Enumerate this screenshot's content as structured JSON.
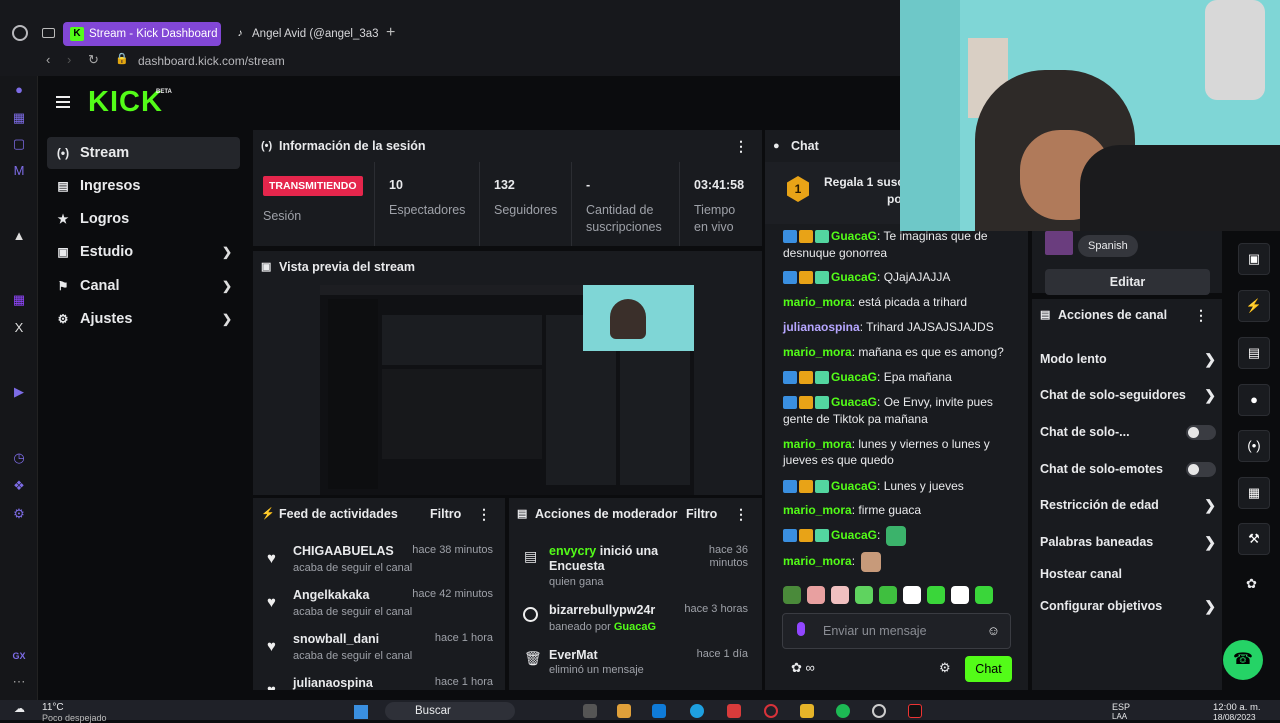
{
  "browser": {
    "tabs": [
      {
        "label": "Stream - Kick Dashboard",
        "active": true
      },
      {
        "label": "Angel Avid (@angel_3a3)",
        "active": false
      }
    ],
    "url": "dashboard.kick.com/stream"
  },
  "brand": {
    "logo_text": "KICK",
    "beta": "BETA",
    "accent": "#53fc18"
  },
  "sidebar": {
    "items": [
      {
        "label": "Stream",
        "icon": "broadcast-icon",
        "active": true
      },
      {
        "label": "Ingresos",
        "icon": "chart-icon"
      },
      {
        "label": "Logros",
        "icon": "trophy-icon"
      },
      {
        "label": "Estudio",
        "icon": "studio-icon",
        "expandable": true
      },
      {
        "label": "Canal",
        "icon": "flag-icon",
        "expandable": true
      },
      {
        "label": "Ajustes",
        "icon": "gear-icon",
        "expandable": true
      }
    ]
  },
  "session": {
    "title": "Información de la sesión",
    "live_badge": "TRANSMITIENDO",
    "session_label": "Sesión",
    "stats": [
      {
        "value": "10",
        "label": "Espectadores"
      },
      {
        "value": "132",
        "label": "Seguidores"
      },
      {
        "value": "-",
        "label": "Cantidad de suscripciones"
      },
      {
        "value": "03:41:58",
        "label": "Tiempo en vivo"
      }
    ]
  },
  "preview": {
    "title": "Vista previa del stream"
  },
  "feed": {
    "title": "Feed de actividades",
    "filter": "Filtro",
    "items": [
      {
        "name": "CHIGAABUELAS",
        "sub": "acaba de seguir el canal",
        "time": "hace 38 minutos"
      },
      {
        "name": "Angelkakaka",
        "sub": "acaba de seguir el canal",
        "time": "hace 42 minutos"
      },
      {
        "name": "snowball_dani",
        "sub": "acaba de seguir el canal",
        "time": "hace 1 hora"
      },
      {
        "name": "julianaospina",
        "sub": "",
        "time": "hace 1 hora"
      }
    ]
  },
  "modactions": {
    "title": "Acciones de moderador",
    "filter": "Filtro",
    "items": [
      {
        "name": "envycry",
        "action": " inició una Encuesta",
        "sub": "quien gana",
        "time": "hace 36 minutos"
      },
      {
        "name": "bizarrebullypw24r",
        "action": "",
        "sub_prefix": "baneado por ",
        "sub_user": "GuacaG",
        "time": "hace 3 horas"
      },
      {
        "name": "EverMat",
        "action": "",
        "sub": "eliminó un mensaje",
        "time": "hace 1 día"
      }
    ]
  },
  "chat": {
    "title": "Chat",
    "pinned": "Regala 1 suscr",
    "pinned2": "po",
    "pinned_rank": "1",
    "messages": [
      {
        "user": "GuacaG",
        "badges": true,
        "color": "green",
        "text": ": Te imaginas que de desnuque gonorrea"
      },
      {
        "user": "GuacaG",
        "badges": true,
        "color": "green",
        "text": ": QJajAJAJJA"
      },
      {
        "user": "mario_mora",
        "badges": false,
        "color": "green",
        "text": ": está picada a trihard"
      },
      {
        "user": "julianaospina",
        "badges": false,
        "color": "purple",
        "text": ": Trihard JAJSAJSJAJDS"
      },
      {
        "user": "mario_mora",
        "badges": false,
        "color": "green",
        "text": ": mañana es que es among?"
      },
      {
        "user": "GuacaG",
        "badges": true,
        "color": "green",
        "text": ": Epa mañana"
      },
      {
        "user": "GuacaG",
        "badges": true,
        "color": "green",
        "text": ": Oe Envy, invite pues gente de Tiktok pa mañana"
      },
      {
        "user": "mario_mora",
        "badges": false,
        "color": "green",
        "text": ": lunes y viernes o lunes y jueves es que quedo"
      },
      {
        "user": "GuacaG",
        "badges": true,
        "color": "green",
        "text": ": Lunes y jueves"
      },
      {
        "user": "mario_mora",
        "badges": false,
        "color": "green",
        "text": ": firme guaca"
      },
      {
        "user": "GuacaG",
        "badges": true,
        "color": "green",
        "text": ":"
      },
      {
        "user": "mario_mora",
        "badges": false,
        "color": "green",
        "text": ":"
      }
    ],
    "input_placeholder": "Enviar un mensaje",
    "send": "Chat",
    "emote_colors": [
      "#4a8a3a",
      "#e8a0a0",
      "#f0c0c0",
      "#5fd35f",
      "#3fbf3f",
      "#ffffff",
      "#3ad63a",
      "#ffffff",
      "#3ad63a"
    ]
  },
  "channel_info": {
    "language": "Spanish",
    "edit": "Editar"
  },
  "channel_actions": {
    "title": "Acciones de canal",
    "items": [
      {
        "label": "Modo lento",
        "kind": "arrow"
      },
      {
        "label": "Chat de solo-seguidores",
        "kind": "arrow"
      },
      {
        "label": "Chat de solo-...",
        "kind": "toggle"
      },
      {
        "label": "Chat de solo-emotes",
        "kind": "toggle"
      },
      {
        "label": "Restricción de edad",
        "kind": "arrow"
      },
      {
        "label": "Palabras baneadas",
        "kind": "arrow"
      },
      {
        "label": "Hostear canal",
        "kind": "none"
      },
      {
        "label": "Configurar objetivos",
        "kind": "arrow"
      }
    ]
  },
  "taskbar": {
    "weather_temp": "11°C",
    "weather_desc": "Poco despejado",
    "search": "Buscar",
    "lang": "ESP",
    "lang2": "LAA",
    "time": "12:00 a. m.",
    "date": "18/08/2023"
  }
}
